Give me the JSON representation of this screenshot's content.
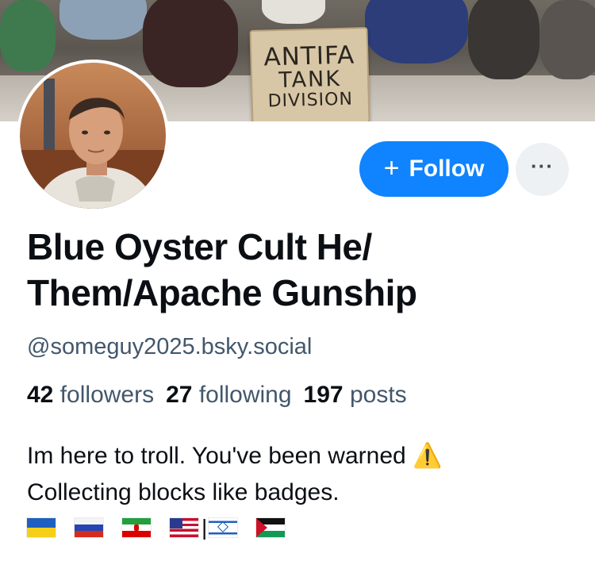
{
  "banner": {
    "sign_line1": "ANTIFA",
    "sign_line2": "TANK",
    "sign_line3": "DIVISION"
  },
  "profile": {
    "avatar_icon": "user-avatar-photo",
    "display_name": "Blue Oyster Cult He/ Them/Apache Gunship",
    "handle": "@someguy2025.bsky.social"
  },
  "actions": {
    "follow_icon": "plus",
    "follow_label": "Follow",
    "more_label": "···",
    "more_icon": "more-horizontal-icon"
  },
  "stats": {
    "followers_count": "42",
    "followers_label": "followers",
    "following_count": "27",
    "following_label": "following",
    "posts_count": "197",
    "posts_label": "posts"
  },
  "bio": {
    "line1": "Im here to troll. You've been warned ⚠️",
    "line2": "Collecting blocks like badges.",
    "flags_separator": "|",
    "flags": [
      "ukraine-flag",
      "russia-flag",
      "iran-flag",
      "usa-flag",
      "israel-flag",
      "palestine-flag"
    ]
  },
  "colors": {
    "accent": "#1083fe",
    "muted_text": "#42576c",
    "text": "#0b0f14"
  }
}
